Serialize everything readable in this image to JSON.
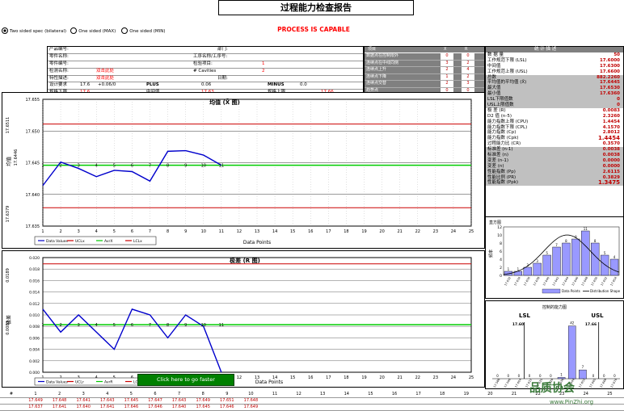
{
  "title": "过程能力检查报告",
  "status": "PROCESS IS CAPABLE",
  "spec_options": [
    {
      "label": "Two sided spec (bilateral)",
      "selected": true
    },
    {
      "label": "One sided (MAX)",
      "selected": false
    },
    {
      "label": "One sided (MIN)",
      "selected": false
    }
  ],
  "info": {
    "part_name_label": "产品编号:",
    "part_name2_label": "零件名称:",
    "part_num_label": "零件编号:",
    "part_desc_label": "检测名称:",
    "feature_label": "特性描述:",
    "dept_label": "部门:",
    "process_label": "工序名称/工序号:",
    "gauge_label": "检验项目:",
    "record_label": "检测数量:",
    "date_label": "日期:",
    "upper_label": "设计要求",
    "upper_value": "17.6",
    "tol_value": "+0.06/0",
    "plus_label": "PLUS",
    "plus_value": "0.06",
    "minus_label": "MINUS",
    "minus_value": "0.0",
    "lsl_label": "规格下限",
    "lsl_value": "17.6",
    "mid_label": "中间值",
    "mid_value": "17.63",
    "usl_label": "规格上限",
    "usl_value": "17.66",
    "cavities_label": "# Cavities",
    "value_1": "1",
    "value_2": "2",
    "input_hint": "双击此处"
  },
  "stats_table": {
    "header": [
      "项目",
      "X",
      "R"
    ],
    "rows": [
      {
        "label": "数据点在控制限外",
        "x": "0",
        "r": "0"
      },
      {
        "label": "连续点在中线同侧",
        "x": "3",
        "r": "2"
      },
      {
        "label": "连续点上升",
        "x": "2",
        "r": "4"
      },
      {
        "label": "连续点下降",
        "x": "1",
        "r": "2"
      },
      {
        "label": "连续点交替",
        "x": "2",
        "r": "3"
      },
      {
        "label": "趋势点",
        "x": "0",
        "r": "0"
      },
      {
        "label": "总计违规数",
        "x": "0",
        "r": "0"
      }
    ]
  },
  "summary": {
    "header": "统 计 描 述",
    "rows": [
      {
        "label": "数 据 量",
        "value": "50"
      },
      {
        "label": "工作规范下限 (LSL)",
        "value": "17.6000"
      },
      {
        "label": "中间值",
        "value": "17.6300"
      },
      {
        "label": "工作规范上限 (USL)",
        "value": "17.6600"
      },
      {
        "label": "总数",
        "value": "882.2260"
      },
      {
        "label": "平均值的平均值 (X̄)",
        "value": "17.6445"
      },
      {
        "label": "最大值",
        "value": "17.6530"
      },
      {
        "label": "最小值",
        "value": "17.6360"
      },
      {
        "label": "LSL下限值数",
        "value": "0"
      },
      {
        "label": "USL上限值数",
        "value": "0"
      },
      {
        "label": "极 差 (R)",
        "value": "0.0083"
      },
      {
        "label": "D2 值 (n-5)",
        "value": "2.3260"
      },
      {
        "label": "能力指数上限 (CPU)",
        "value": "1.4454"
      },
      {
        "label": "能力指数下限 (CPL)",
        "value": "4.1570"
      },
      {
        "label": "能力指数 (Cp)",
        "value": "2.8012"
      },
      {
        "label": "能力指数 (Cpk)",
        "value": "1.4454"
      },
      {
        "label": "过程能力比 (CR)",
        "value": "0.3570"
      },
      {
        "label": "标准差 (n-1)",
        "value": "0.0038"
      },
      {
        "label": "标准差 (n)",
        "value": "0.0038"
      },
      {
        "label": "变差 (n-1)",
        "value": "0.0000"
      },
      {
        "label": "变差 (n)",
        "value": "0.0000"
      },
      {
        "label": "性能指数 (Pp)",
        "value": "2.6115"
      },
      {
        "label": "性能比例 (PR)",
        "value": "0.3829"
      },
      {
        "label": "性能指数 (Ppk)",
        "value": "1.3475"
      }
    ]
  },
  "xbar_chart": {
    "title": "均值 (X̄ 图)",
    "ylabel": "均值",
    "ucl_label": "17.6511",
    "cl_label": "17.6446",
    "lcl_label": "17.6379",
    "legend": [
      "Data Values",
      "UCLx",
      "AvrX",
      "LCLx"
    ],
    "xlabel": "Data Points"
  },
  "range_chart": {
    "title": "极差 (R 图)",
    "ylabel": "极差",
    "ucl_label": "0.0189",
    "cl_label": "0.0083",
    "legend": [
      "Data Values",
      "UCLr",
      "AvrR",
      "LCLr"
    ],
    "xlabel": "Data Points"
  },
  "histogram": {
    "title": "直方图",
    "ylabel": "频率",
    "legend": [
      "Data Points",
      "Distribution Shape"
    ]
  },
  "capability_chart": {
    "title": "控制的能力图",
    "lsl_label": "LSL",
    "usl_label": "USL",
    "lsl_value": "17.60",
    "usl_value": "17.66"
  },
  "goto_button": "Click here to go faster",
  "bottom": {
    "row_label": "#",
    "numbers": [
      "1",
      "2",
      "3",
      "4",
      "5",
      "6",
      "7",
      "8",
      "9",
      "10",
      "11",
      "12",
      "13",
      "14",
      "15",
      "16",
      "17",
      "18",
      "19",
      "20",
      "21",
      "22",
      "23",
      "24",
      "25"
    ],
    "row1": [
      "17.649",
      "17.648",
      "17.641",
      "17.643",
      "17.645",
      "17.647",
      "17.643",
      "17.649",
      "17.651",
      "17.648"
    ],
    "row2": [
      "17.637",
      "17.641",
      "17.640",
      "17.641",
      "17.646",
      "17.646",
      "17.640",
      "17.645",
      "17.646",
      "17.649"
    ]
  },
  "watermark": "品质协会",
  "watermark_url": "www.PinZhi.org",
  "chart_data": [
    {
      "type": "line",
      "title": "均值 (X̄ 图)",
      "xlabel": "Data Points",
      "ylabel": "均值",
      "x": [
        1,
        2,
        3,
        4,
        5,
        6,
        7,
        8,
        9,
        10,
        11
      ],
      "series": [
        {
          "name": "Data Values",
          "values": [
            17.6414,
            17.6451,
            17.6441,
            17.6428,
            17.6438,
            17.6436,
            17.6421,
            17.6468,
            17.6469,
            17.6462,
            17.6446
          ]
        },
        {
          "name": "UCLx",
          "values": [
            17.6511
          ]
        },
        {
          "name": "AvrX",
          "values": [
            17.6446
          ]
        },
        {
          "name": "LCLx",
          "values": [
            17.6379
          ]
        }
      ],
      "ylim": [
        17.635,
        17.655
      ],
      "xlim": [
        1,
        25
      ]
    },
    {
      "type": "line",
      "title": "极差 (R 图)",
      "xlabel": "Data Points",
      "ylabel": "极差",
      "x": [
        1,
        2,
        3,
        4,
        5,
        6,
        7,
        8,
        9,
        10,
        11
      ],
      "series": [
        {
          "name": "Data Values",
          "values": [
            0.011,
            0.007,
            0.01,
            0.007,
            0.004,
            0.011,
            0.01,
            0.006,
            0.01,
            0.008,
            0.0
          ]
        },
        {
          "name": "UCLr",
          "values": [
            0.0189
          ]
        },
        {
          "name": "AvrR",
          "values": [
            0.0083
          ]
        }
      ],
      "ylim": [
        0,
        0.02
      ],
      "xlim": [
        1,
        25
      ]
    },
    {
      "type": "bar",
      "title": "直方图",
      "ylabel": "频率",
      "categories": [
        "17.632",
        "17.634",
        "17.636",
        "17.638",
        "17.640",
        "17.642",
        "17.644",
        "17.646",
        "17.648",
        "17.650",
        "17.652",
        "17.654"
      ],
      "series": [
        {
          "name": "Data Points",
          "values": [
            1,
            1,
            2,
            3,
            5,
            7,
            8,
            9,
            11,
            8,
            5,
            4
          ]
        }
      ],
      "ylim": [
        0,
        12
      ]
    },
    {
      "type": "bar",
      "title": "控制的能力图",
      "categories": [
        "17.588",
        "17.596",
        "17.604",
        "17.612",
        "17.620",
        "17.628",
        "17.636",
        "17.644",
        "17.652",
        "17.660",
        "17.668",
        "17.676"
      ],
      "series": [
        {
          "name": "Data Points",
          "values": [
            0,
            0,
            0,
            0,
            0,
            0,
            1,
            42,
            7,
            0,
            0,
            0
          ]
        }
      ],
      "ylim": [
        0,
        45
      ]
    }
  ]
}
